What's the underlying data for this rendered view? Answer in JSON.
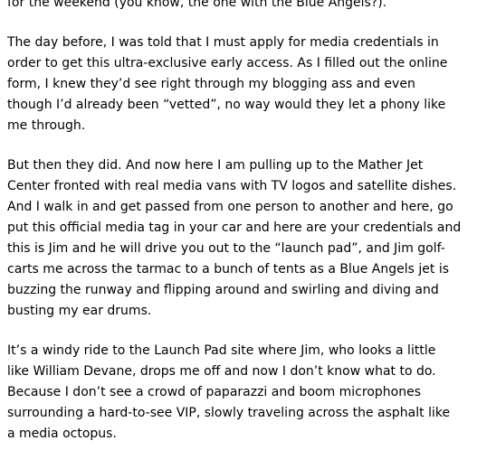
{
  "post": {
    "paragraphs": [
      "for the weekend (you know, the one with the Blue Angels?).",
      "The day before, I was told that I must apply for media credentials in\norder to get this ultra-exclusive early access. As I filled out the online\nform, I knew they’d see right through my blogging ass and even\nthough I’d already been “vetted”, no way would they let a phony like\nme through.",
      "But then they did. And now here I am pulling up to the Mather Jet\nCenter fronted with real media vans with TV logos and satellite dishes.\nAnd I walk in and get passed from one person to another and here, go\nput this official media tag in your car and here are your credentials and\nthis is Jim and he will drive you out to the “launch pad”, and Jim golf-\ncarts me across the tarmac to a bunch of tents as a Blue Angels jet is\nbuzzing the runway and flipping around and swirling and diving and\nbusting my ear drums.",
      "It’s a windy ride to the Launch Pad site where Jim, who looks a little\nlike William Devane, drops me off and now I don’t know what to do.\nBecause I don’t see a crowd of paparazzi and boom microphones\nsurrounding a hard-to-see VIP, slowly traveling across the asphalt like\na media octopus."
    ]
  }
}
